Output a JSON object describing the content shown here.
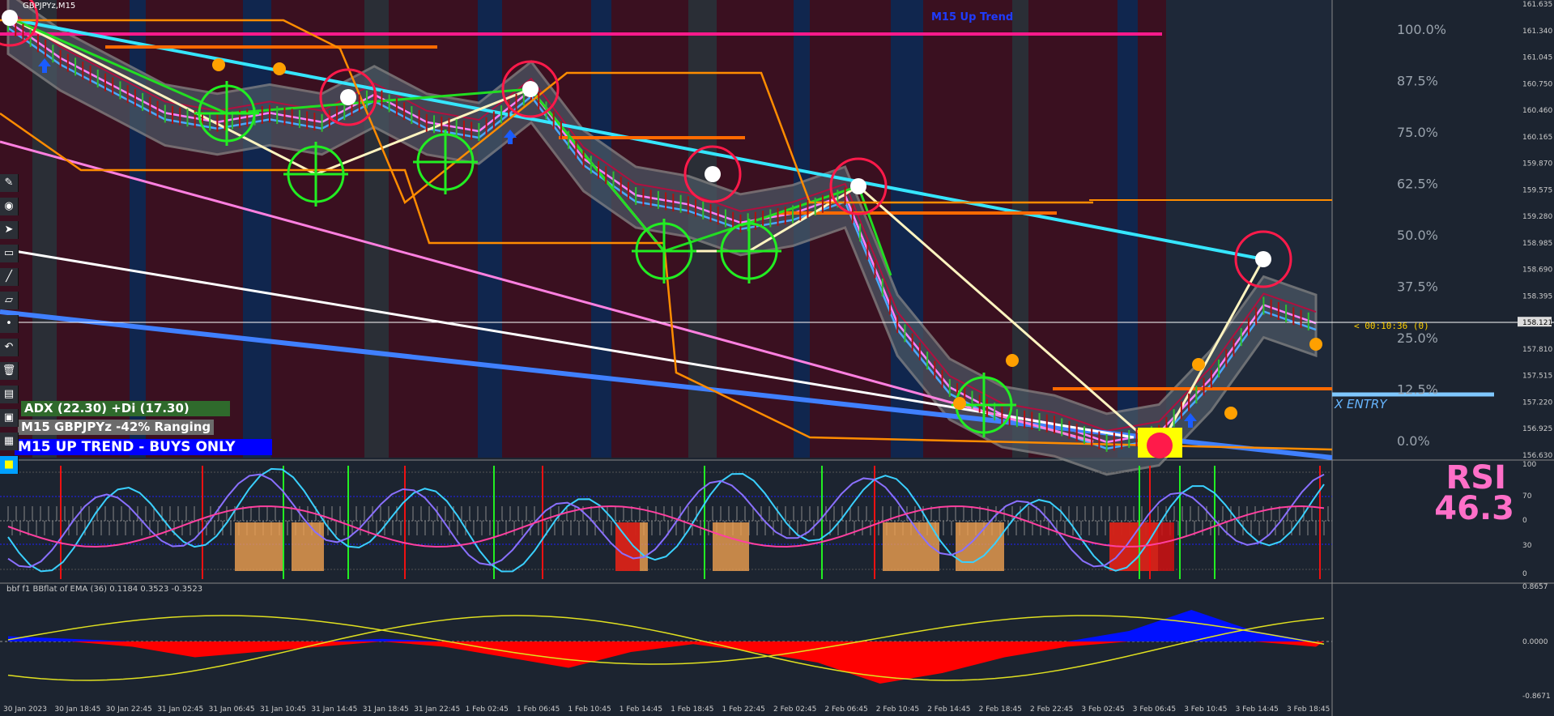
{
  "window": {
    "title": "GBPJPYz,M15"
  },
  "chart_title": "M15 Up Trend",
  "price_axis": {
    "ticks": [
      "161.635",
      "161.340",
      "161.045",
      "160.750",
      "160.460",
      "160.165",
      "159.870",
      "159.575",
      "159.280",
      "158.985",
      "158.690",
      "158.395",
      "158.121",
      "157.810",
      "157.515",
      "157.220",
      "156.925",
      "156.630"
    ],
    "current": "158.121"
  },
  "fib_levels": [
    {
      "label": "100.0%"
    },
    {
      "label": "87.5%"
    },
    {
      "label": "75.0%"
    },
    {
      "label": "62.5%"
    },
    {
      "label": "50.0%"
    },
    {
      "label": "37.5%"
    },
    {
      "label": "25.0%"
    },
    {
      "label": "12.5%"
    },
    {
      "label": "0.0%"
    }
  ],
  "countdown": "< 00:10:36 (0)",
  "fx_entry": "X ENTRY",
  "info_boxes": {
    "adx": "ADX (22.30)   +Di (17.30)",
    "ranging": "M15 GBPJPYz -42% Ranging",
    "trend": "M15 UP TREND - BUYS ONLY"
  },
  "rsi": {
    "label": "RSI",
    "value": "46.3",
    "axis": [
      "100",
      "70",
      "0",
      "30",
      "0"
    ]
  },
  "bbf": {
    "title": "bbf f1 BBflat of EMA (36) 0.1184 0.3523 -0.3523",
    "axis_top": "0.8657",
    "axis_mid": "0.0000",
    "axis_bottom": "-0.8671"
  },
  "time_axis": [
    "30 Jan 2023",
    "30 Jan 18:45",
    "30 Jan 22:45",
    "31 Jan 02:45",
    "31 Jan 06:45",
    "31 Jan 10:45",
    "31 Jan 14:45",
    "31 Jan 18:45",
    "31 Jan 22:45",
    "1 Feb 02:45",
    "1 Feb 06:45",
    "1 Feb 10:45",
    "1 Feb 14:45",
    "1 Feb 18:45",
    "1 Feb 22:45",
    "2 Feb 02:45",
    "2 Feb 06:45",
    "2 Feb 10:45",
    "2 Feb 14:45",
    "2 Feb 18:45",
    "2 Feb 22:45",
    "3 Feb 02:45",
    "3 Feb 06:45",
    "3 Feb 10:45",
    "3 Feb 14:45",
    "3 Feb 18:45"
  ],
  "toolbar": [
    "pen-icon",
    "eye-icon",
    "cursor-icon",
    "ruler-icon",
    "line-icon",
    "eraser-icon",
    "dot-icon",
    "undo-icon",
    "trash-icon",
    "truck-icon",
    "camera-icon",
    "doc-icon",
    "color-icon"
  ],
  "colors": {
    "bull_zone": "#10264e",
    "bear_zone": "#3a1020",
    "cloud": "#4a5663",
    "price": "#c8c8c8",
    "rsi_pink": "#ff6fc8",
    "bbf_up": "#0010ff",
    "bbf_down": "#ff0000"
  },
  "chart_data": {
    "type": "line",
    "title": "M15 Up Trend",
    "x": [
      "30 Jan 2023",
      "30 Jan 18:45",
      "30 Jan 22:45",
      "31 Jan 02:45",
      "31 Jan 06:45",
      "31 Jan 10:45",
      "31 Jan 14:45",
      "31 Jan 18:45",
      "31 Jan 22:45",
      "1 Feb 02:45",
      "1 Feb 06:45",
      "1 Feb 10:45",
      "1 Feb 14:45",
      "1 Feb 18:45",
      "1 Feb 22:45",
      "2 Feb 02:45",
      "2 Feb 06:45",
      "2 Feb 10:45",
      "2 Feb 14:45",
      "2 Feb 18:45",
      "2 Feb 22:45",
      "3 Feb 02:45",
      "3 Feb 06:45",
      "3 Feb 10:45",
      "3 Feb 14:45",
      "3 Feb 18:45"
    ],
    "series": [
      {
        "values": [
          161.4,
          161.0,
          160.7,
          160.4,
          160.3,
          160.4,
          160.3,
          160.6,
          160.3,
          160.2,
          160.65,
          159.9,
          159.5,
          159.4,
          159.2,
          159.3,
          159.5,
          158.1,
          157.4,
          157.1,
          157.0,
          156.8,
          156.9,
          157.5,
          158.3,
          158.1
        ]
      }
    ],
    "ylim": [
      156.63,
      161.635
    ],
    "rsi_last": 46.3
  }
}
